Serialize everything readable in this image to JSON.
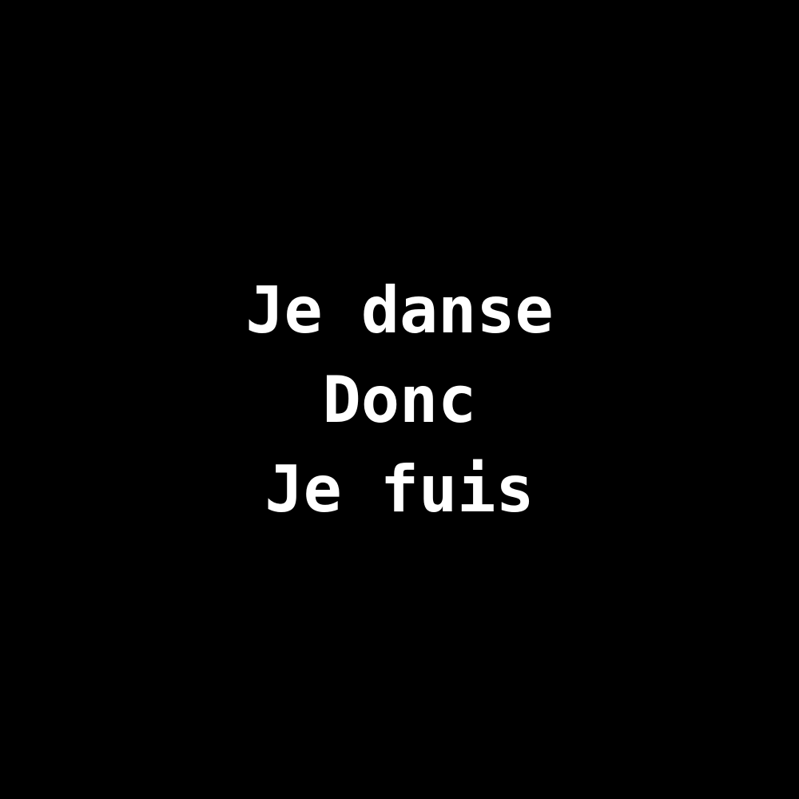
{
  "colors": {
    "background": "#000000",
    "text": "#ffffff"
  },
  "text": {
    "line1": "Je danse",
    "line2": "Donc",
    "line3": "Je fuis"
  }
}
